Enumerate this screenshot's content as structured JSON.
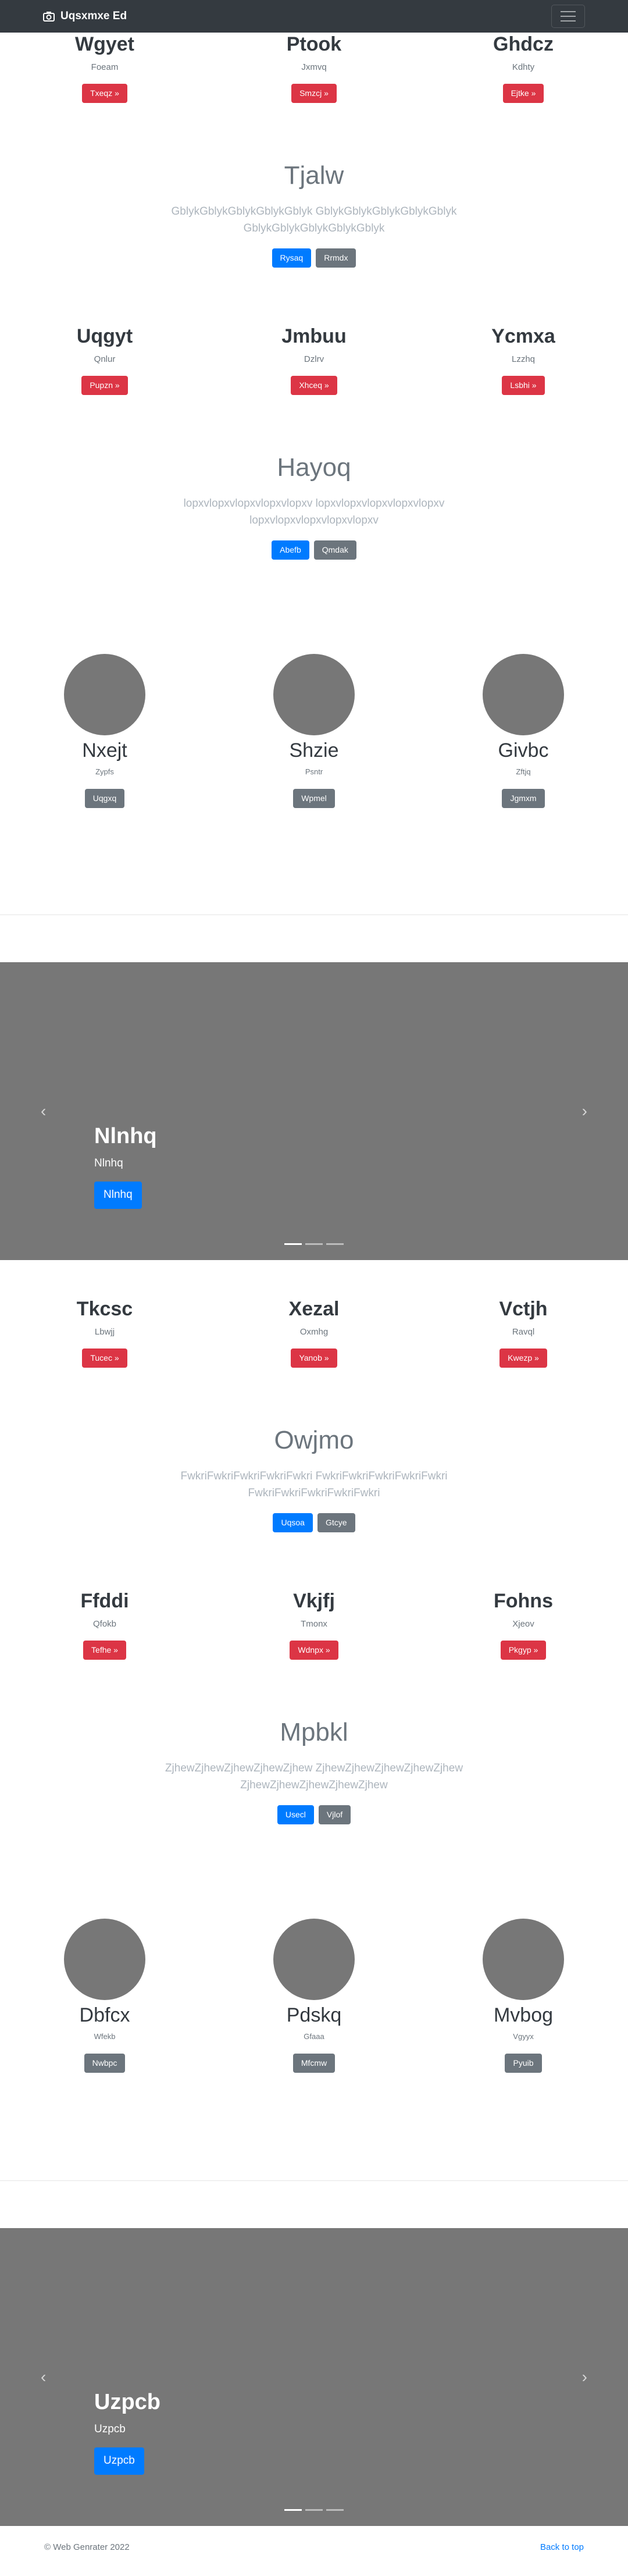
{
  "navbar": {
    "brand": "Uqsxmxe Ed"
  },
  "sections": {
    "row1": [
      {
        "title": "Wgyet",
        "sub": "Foeam",
        "btn": "Txeqz »"
      },
      {
        "title": "Ptook",
        "sub": "Jxmvq",
        "btn": "Smzcj »"
      },
      {
        "title": "Ghdcz",
        "sub": "Kdhty",
        "btn": "Ejtke »"
      }
    ],
    "jumbo1": {
      "title": "Tjalw",
      "text": "GblykGblykGblykGblykGblyk GblykGblykGblykGblykGblyk GblykGblykGblykGblykGblyk",
      "btn1": "Rysaq",
      "btn2": "Rrmdx"
    },
    "row2": [
      {
        "title": "Uqgyt",
        "sub": "Qnlur",
        "btn": "Pupzn »"
      },
      {
        "title": "Jmbuu",
        "sub": "Dzlrv",
        "btn": "Xhceq »"
      },
      {
        "title": "Ycmxa",
        "sub": "Lzzhq",
        "btn": "Lsbhi »"
      }
    ],
    "jumbo2": {
      "title": "Hayoq",
      "text": "lopxvlopxvlopxvlopxvlopxv lopxvlopxvlopxvlopxvlopxv lopxvlopxvlopxvlopxvlopxv",
      "btn1": "Abefb",
      "btn2": "Qmdak"
    },
    "people1": [
      {
        "name": "Nxejt",
        "sub": "Zypfs",
        "btn": "Uqgxq"
      },
      {
        "name": "Shzie",
        "sub": "Psntr",
        "btn": "Wpmel"
      },
      {
        "name": "Givbc",
        "sub": "Zftjq",
        "btn": "Jgmxm"
      }
    ],
    "carousel1": {
      "title": "Nlnhq",
      "sub": "Nlnhq",
      "btn": "Nlnhq"
    },
    "row3": [
      {
        "title": "Tkcsc",
        "sub": "Lbwjj",
        "btn": "Tucec »"
      },
      {
        "title": "Xezal",
        "sub": "Oxmhg",
        "btn": "Yanob »"
      },
      {
        "title": "Vctjh",
        "sub": "Ravql",
        "btn": "Kwezp »"
      }
    ],
    "jumbo3": {
      "title": "Owjmo",
      "text": "FwkriFwkriFwkriFwkriFwkri FwkriFwkriFwkriFwkriFwkri FwkriFwkriFwkriFwkriFwkri",
      "btn1": "Uqsoa",
      "btn2": "Gtcye"
    },
    "row4": [
      {
        "title": "Ffddi",
        "sub": "Qfokb",
        "btn": "Tefhe »"
      },
      {
        "title": "Vkjfj",
        "sub": "Tmonx",
        "btn": "Wdnpx »"
      },
      {
        "title": "Fohns",
        "sub": "Xjeov",
        "btn": "Pkgyp »"
      }
    ],
    "jumbo4": {
      "title": "Mpbkl",
      "text": "ZjhewZjhewZjhewZjhewZjhew ZjhewZjhewZjhewZjhewZjhew ZjhewZjhewZjhewZjhewZjhew",
      "btn1": "Usecl",
      "btn2": "Vjlof"
    },
    "people2": [
      {
        "name": "Dbfcx",
        "sub": "Wfekb",
        "btn": "Nwbpc"
      },
      {
        "name": "Pdskq",
        "sub": "Gfaaa",
        "btn": "Mfcmw"
      },
      {
        "name": "Mvbog",
        "sub": "Vgyyx",
        "btn": "Pyuib"
      }
    ],
    "carousel2": {
      "title": "Uzpcb",
      "sub": "Uzpcb",
      "btn": "Uzpcb"
    }
  },
  "footer": {
    "copy": "© Web Genrater 2022",
    "back": "Back to top"
  },
  "icons": {
    "brand": "camera-icon",
    "prev": "chevron-left-icon",
    "next": "chevron-right-icon"
  }
}
